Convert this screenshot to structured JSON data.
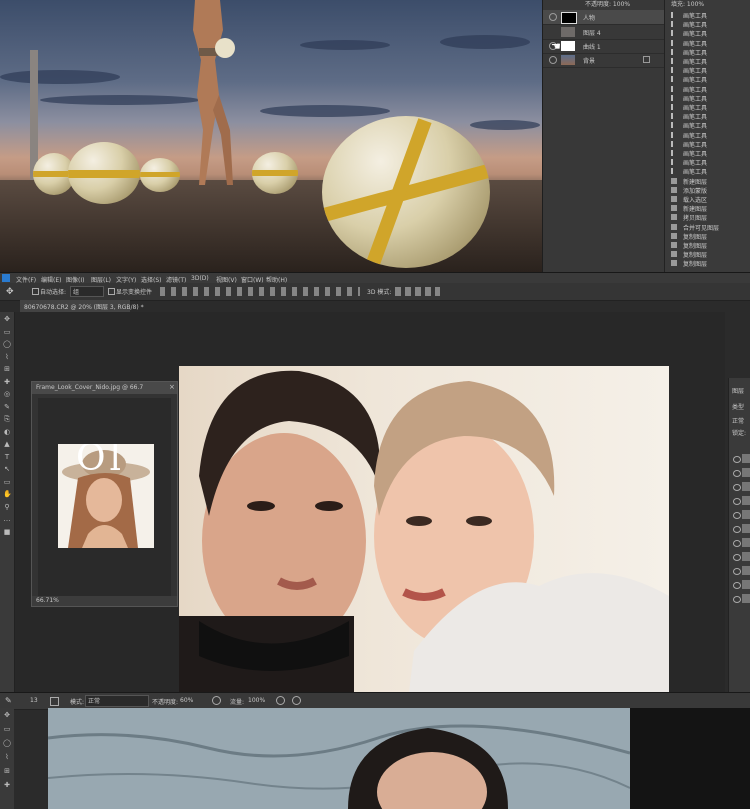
{
  "layers_panel": {
    "opacity_label": "不透明度: 100%",
    "fill_label": "填充: 100%",
    "layers": [
      {
        "name": "人物",
        "selected": true
      },
      {
        "name": "图层 4",
        "selected": false
      },
      {
        "name": "曲线 1",
        "selected": false
      },
      {
        "name": "背景",
        "selected": false
      }
    ]
  },
  "history_panel": {
    "items": [
      "画笔工具",
      "画笔工具",
      "画笔工具",
      "画笔工具",
      "画笔工具",
      "画笔工具",
      "画笔工具",
      "画笔工具",
      "画笔工具",
      "画笔工具",
      "画笔工具",
      "画笔工具",
      "画笔工具",
      "画笔工具",
      "画笔工具",
      "画笔工具",
      "画笔工具",
      "画笔工具",
      "新建图层",
      "添加蒙版",
      "载入选区",
      "新建图层",
      "拷贝图层",
      "合并可见图层",
      "复制图层",
      "复制图层",
      "复制图层",
      "复制图层"
    ]
  },
  "menubar": {
    "items": [
      "文件(F)",
      "编辑(E)",
      "图像(I)",
      "图层(L)",
      "文字(Y)",
      "选择(S)",
      "滤镜(T)",
      "3D(D)",
      "视图(V)",
      "窗口(W)",
      "帮助(H)"
    ]
  },
  "options_bar": {
    "auto_select_label": "自动选择:",
    "auto_select_value": "组",
    "show_transform_label": "显示变换控件",
    "mode_3d": "3D 模式:"
  },
  "document_tab": {
    "title": "80670678.CR2 @ 20% (图层 3, RGB/8) *"
  },
  "float_window": {
    "title": "Frame_Look_Cover_Nido.jpg @ 66.7",
    "zoom": "66.71%",
    "cover_text": "Ol"
  },
  "right_panel": {
    "tab": "图层",
    "kind": "类型",
    "mode": "正常",
    "lock": "锁定:"
  },
  "options_bar2": {
    "brush_size": "13",
    "mode_label": "模式:",
    "mode_value": "正常",
    "opacity_label": "不透明度:",
    "opacity_value": "60%",
    "flow_label": "流量:",
    "flow_value": "100%"
  },
  "colors": {
    "ui_dark": "#2b2b2b",
    "panel": "#383838",
    "ball_yellow": "#d0a52a",
    "selection": "#4a4a4a"
  }
}
